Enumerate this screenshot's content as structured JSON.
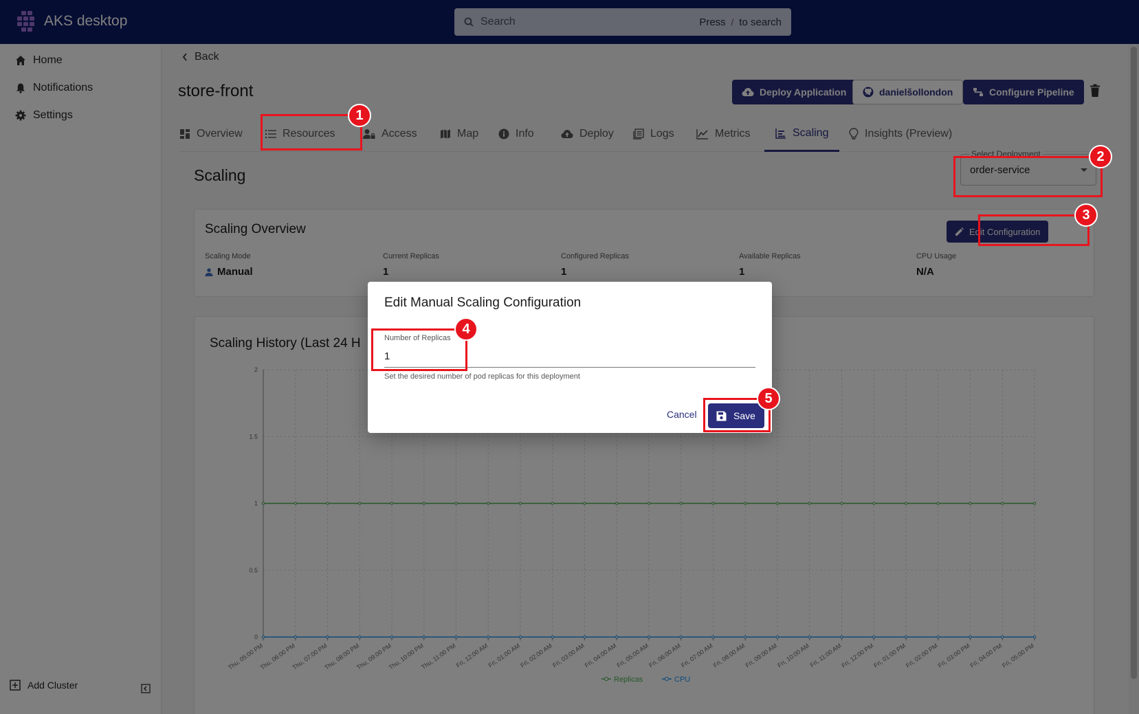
{
  "app": {
    "title": "AKS desktop"
  },
  "search": {
    "placeholder": "Search",
    "hint_press": "Press",
    "hint_key": "/",
    "hint_suffix": "to search"
  },
  "sidebar": {
    "items": [
      {
        "label": "Home",
        "icon": "home-icon"
      },
      {
        "label": "Notifications",
        "icon": "bell-icon"
      },
      {
        "label": "Settings",
        "icon": "gear-icon"
      }
    ],
    "footer_label": "Add Cluster"
  },
  "page": {
    "back_label": "Back",
    "title": "store-front",
    "deploy_label": "Deploy Application",
    "github_label": "danielšollondon",
    "pipeline_label": "Configure Pipeline"
  },
  "tabs": [
    {
      "label": "Overview"
    },
    {
      "label": "Resources"
    },
    {
      "label": "Access"
    },
    {
      "label": "Map"
    },
    {
      "label": "Info"
    },
    {
      "label": "Deploy"
    },
    {
      "label": "Logs"
    },
    {
      "label": "Metrics"
    },
    {
      "label": "Scaling"
    },
    {
      "label": "Insights (Preview)"
    }
  ],
  "scaling": {
    "section_title": "Scaling",
    "select_label": "Select Deployment",
    "select_value": "order-service",
    "overview_title": "Scaling Overview",
    "edit_label": "Edit Configuration",
    "metrics": [
      {
        "label": "Scaling Mode",
        "value": "Manual"
      },
      {
        "label": "Current Replicas",
        "value": "1"
      },
      {
        "label": "Configured Replicas",
        "value": "1"
      },
      {
        "label": "Available Replicas",
        "value": "1"
      },
      {
        "label": "CPU Usage",
        "value": "N/A"
      }
    ],
    "history_title": "Scaling History (Last 24 H"
  },
  "chart_data": {
    "type": "line",
    "title": "Scaling History (Last 24 H",
    "ylim": [
      0,
      2
    ],
    "yticks": [
      "0",
      "0.5",
      "1",
      "1.5",
      "2"
    ],
    "grid": true,
    "legend": "bottom",
    "x": [
      "Thu, 05:00 PM",
      "Thu, 06:00 PM",
      "Thu, 07:00 PM",
      "Thu, 08:00 PM",
      "Thu, 09:00 PM",
      "Thu, 10:00 PM",
      "Thu, 11:00 PM",
      "Fri, 12:00 AM",
      "Fri, 01:00 AM",
      "Fri, 02:00 AM",
      "Fri, 03:00 AM",
      "Fri, 04:00 AM",
      "Fri, 05:00 AM",
      "Fri, 06:00 AM",
      "Fri, 07:00 AM",
      "Fri, 08:00 AM",
      "Fri, 09:00 AM",
      "Fri, 10:00 AM",
      "Fri, 11:00 AM",
      "Fri, 12:00 PM",
      "Fri, 01:00 PM",
      "Fri, 02:00 PM",
      "Fri, 03:00 PM",
      "Fri, 04:00 PM",
      "Fri, 05:00 PM"
    ],
    "series": [
      {
        "name": "Replicas",
        "color": "#4caf50",
        "values": [
          1,
          1,
          1,
          1,
          1,
          1,
          1,
          1,
          1,
          1,
          1,
          1,
          1,
          1,
          1,
          1,
          1,
          1,
          1,
          1,
          1,
          1,
          1,
          1,
          1
        ]
      },
      {
        "name": "CPU",
        "color": "#2196f3",
        "values": [
          0,
          0,
          0,
          0,
          0,
          0,
          0,
          0,
          0,
          0,
          0,
          0,
          0,
          0,
          0,
          0,
          0,
          0,
          0,
          0,
          0,
          0,
          0,
          0,
          0
        ]
      }
    ]
  },
  "dialog": {
    "title": "Edit Manual Scaling Configuration",
    "field_label": "Number of Replicas",
    "field_value": "1",
    "helper": "Set the desired number of pod replicas for this deployment",
    "cancel_label": "Cancel",
    "save_label": "Save"
  },
  "callouts": [
    "1",
    "2",
    "3",
    "4",
    "5"
  ],
  "colors": {
    "topbar": "#0c1b66",
    "primary": "#2a2e7c",
    "callout": "#e8141d"
  }
}
